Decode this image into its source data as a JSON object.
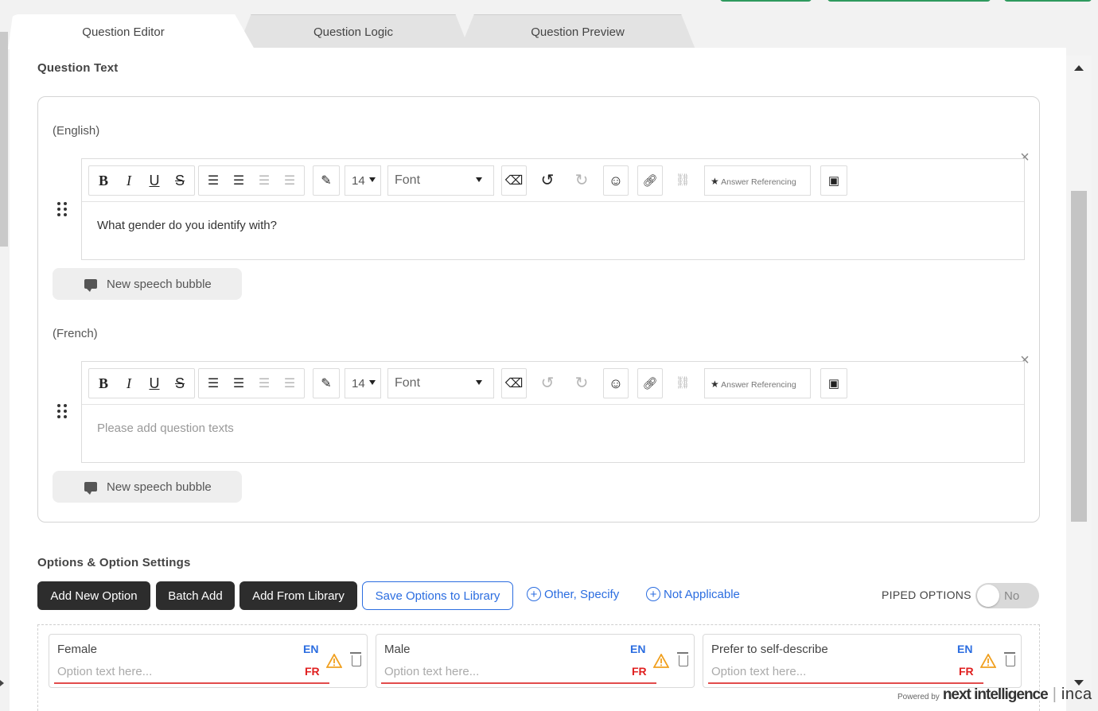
{
  "tabs": [
    {
      "label": "Question Editor",
      "active": true
    },
    {
      "label": "Question Logic",
      "active": false
    },
    {
      "label": "Question Preview",
      "active": false
    }
  ],
  "question_text_title": "Question Text",
  "languages": {
    "english": {
      "label": "(English)",
      "text": "What gender do you identify with?",
      "speech_bubble": "New speech bubble"
    },
    "french": {
      "label": "(French)",
      "placeholder": "Please add question texts",
      "speech_bubble": "New speech bubble"
    }
  },
  "toolbar": {
    "bold": "B",
    "italic": "I",
    "underline": "U",
    "strike": "S",
    "font_size": "14",
    "font": "Font",
    "answer_referencing": "Answer Referencing",
    "icons": [
      "bold-icon",
      "italic-icon",
      "underline-icon",
      "strikethrough-icon",
      "bullet-list-icon",
      "numbered-list-icon",
      "outdent-icon",
      "indent-icon",
      "pen-icon",
      "eraser-icon",
      "undo-icon",
      "redo-icon",
      "emoji-icon",
      "link-icon",
      "unlink-icon",
      "star-icon",
      "image-icon"
    ]
  },
  "options_section": {
    "title": "Options & Option Settings",
    "add_new_option": "Add New Option",
    "batch_add": "Batch Add",
    "add_from_library": "Add From Library",
    "save_options_to_library": "Save Options to Library",
    "other_specify": "Other, Specify",
    "not_applicable": "Not Applicable",
    "piped_options_label": "PIPED OPTIONS",
    "piped_options_value": "No"
  },
  "options": [
    {
      "label": "Female",
      "placeholder": "Option text here...",
      "en": "EN",
      "fr": "FR"
    },
    {
      "label": "Male",
      "placeholder": "Option text here...",
      "en": "EN",
      "fr": "FR"
    },
    {
      "label": "Prefer to self-describe",
      "placeholder": "Option text here...",
      "en": "EN",
      "fr": "FR"
    }
  ],
  "footer": {
    "powered_by": "Powered by",
    "brand1": "next intelligence",
    "brand2": "inca"
  },
  "colors": {
    "accent_blue": "#2b6de0",
    "warning_orange": "#f0a020",
    "fr_red": "#e02020",
    "dark_button": "#2d2d2d"
  }
}
